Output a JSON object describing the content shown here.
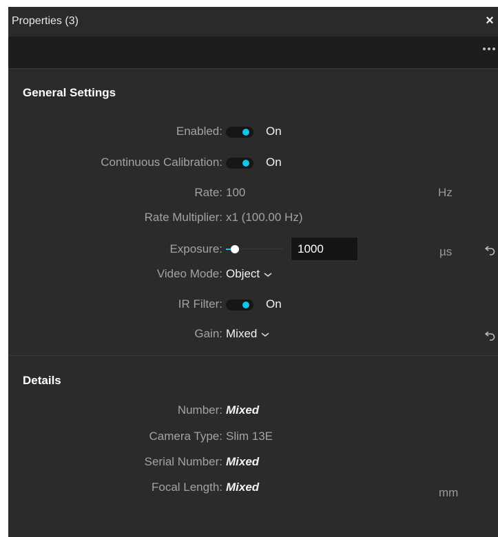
{
  "window": {
    "title": "Properties (3)",
    "close_glyph": "×",
    "more_icon": "more-horizontal-icon"
  },
  "colors": {
    "panel_bg": "#2b2b2b",
    "toolbar_bg": "#1d1d1d",
    "accent": "#11c4e8",
    "label": "#a3a3a3",
    "value": "#f2f2f2"
  },
  "general": {
    "header": "General Settings",
    "enabled": {
      "label": "Enabled:",
      "state": "On",
      "checked": true
    },
    "continuous_calibration": {
      "label": "Continuous Calibration:",
      "state": "On",
      "checked": true
    },
    "rate": {
      "label": "Rate:",
      "value": "100",
      "unit": "Hz"
    },
    "rate_multiplier": {
      "label": "Rate Multiplier:",
      "value": "x1 (100.00 Hz)"
    },
    "exposure": {
      "label": "Exposure:",
      "value": "1000",
      "unit": "µs",
      "slider_fraction": 0.15,
      "reset_icon": "reset-icon"
    },
    "video_mode": {
      "label": "Video Mode:",
      "value": "Object"
    },
    "ir_filter": {
      "label": "IR Filter:",
      "state": "On",
      "checked": true
    },
    "gain": {
      "label": "Gain:",
      "value": "Mixed",
      "reset_icon": "reset-icon"
    }
  },
  "details": {
    "header": "Details",
    "number": {
      "label": "Number:",
      "value": "Mixed"
    },
    "camera_type": {
      "label": "Camera Type:",
      "value": "Slim 13E"
    },
    "serial_number": {
      "label": "Serial Number:",
      "value": "Mixed"
    },
    "focal_length": {
      "label": "Focal Length:",
      "value": "Mixed",
      "unit": "mm"
    }
  }
}
